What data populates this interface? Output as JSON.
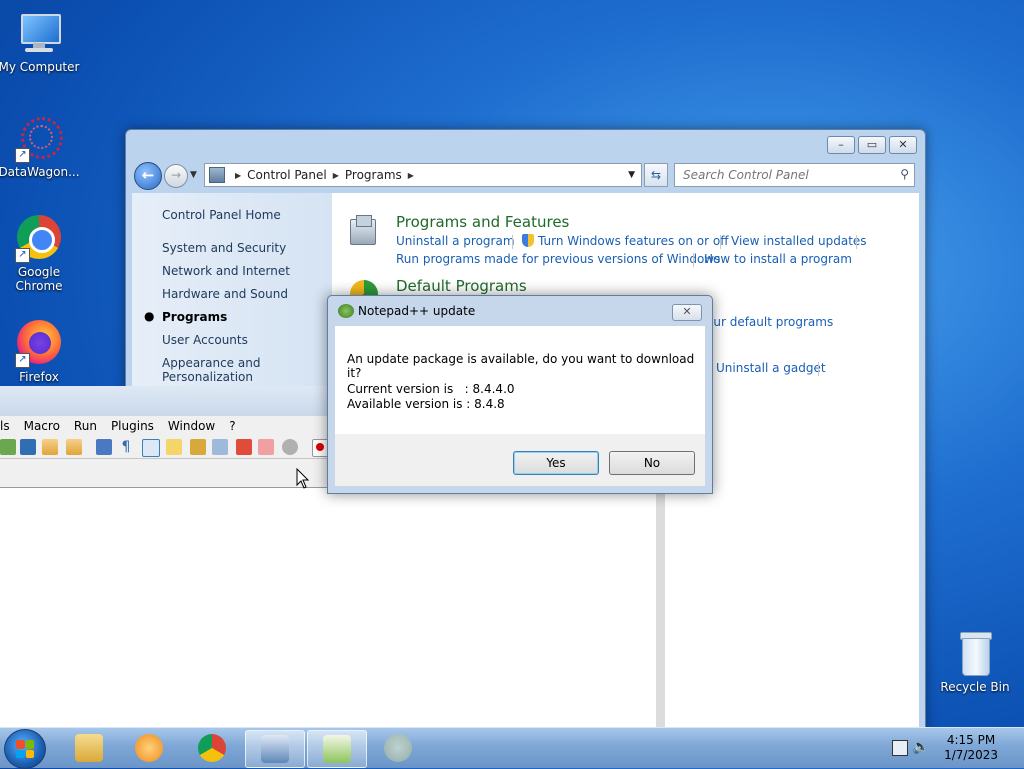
{
  "desktop": {
    "icons": [
      {
        "label": "My Computer",
        "icon": "computer-icon"
      },
      {
        "label": "DataWagon...",
        "icon": "datawagon-icon"
      },
      {
        "label": "Google Chrome",
        "icon": "chrome-icon"
      },
      {
        "label": "Firefox",
        "icon": "firefox-icon"
      },
      {
        "label": "Recycle Bin",
        "icon": "recycle-bin-icon"
      }
    ]
  },
  "control_panel": {
    "breadcrumb": [
      "Control Panel",
      "Programs"
    ],
    "search_placeholder": "Search Control Panel",
    "nav": {
      "home": "Control Panel Home",
      "items": [
        "System and Security",
        "Network and Internet",
        "Hardware and Sound",
        "Programs",
        "User Accounts",
        "Appearance and Personalization"
      ],
      "active": "Programs"
    },
    "sections": {
      "programs_features": {
        "title": "Programs and Features",
        "links": [
          "Uninstall a program",
          "Turn Windows features on or off",
          "View installed updates",
          "Run programs made for previous versions of Windows",
          "How to install a program"
        ]
      },
      "default_programs": {
        "title": "Default Programs",
        "partial_link": "our default programs"
      },
      "gadgets": {
        "partial_link": "Uninstall a gadget"
      }
    }
  },
  "notepad": {
    "menu": [
      "ls",
      "Macro",
      "Run",
      "Plugins",
      "Window",
      "?"
    ]
  },
  "dialog": {
    "title": "Notepad++ update",
    "message": "An update package is available, do you want to download it?",
    "current_label": "Current version is   : 8.4.4.0",
    "available_label": "Available version is : 8.4.8",
    "yes": "Yes",
    "no": "No"
  },
  "taskbar": {
    "time": "4:15 PM",
    "date": "1/7/2023"
  }
}
